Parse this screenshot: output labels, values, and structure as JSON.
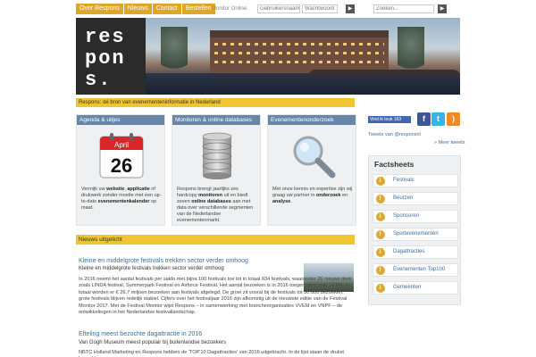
{
  "nav": {
    "tabs": [
      "Over Respons",
      "Nieuws",
      "Contact",
      "Bestellen"
    ],
    "monitor_label": "Monitor Online:",
    "username_placeholder": "Gebruikersnaam",
    "password_placeholder": "Wachtwoord",
    "search_placeholder": "Zoeken...",
    "go_glyph": "▶"
  },
  "logo": {
    "letters": "res\npon\ns."
  },
  "tagline": "Respons: dé bron van evenementeninformatie in Nederland",
  "boxes": [
    {
      "header": "Agenda & uitjes",
      "calendar_month": "April",
      "calendar_day": "26",
      "text_parts": [
        "Vermijk uw ",
        "website",
        ", ",
        "applicatie",
        " of drukwerk zonder moeite met een up-to-date ",
        "evenementenkalender",
        " op maat."
      ]
    },
    {
      "header": "Monitoren & online databases",
      "text_parts": [
        "Respons brengt jaarlijks zes hardcopy ",
        "monitoren",
        " uit en biedt zeven ",
        "online databases",
        " aan met data over verschillende segmenten van de Nederlandse evenementenmarkt."
      ]
    },
    {
      "header": "Evenementenonderzoek",
      "text_parts": [
        "Met onze kennis en expertise zijn wij graag uw partner in ",
        "onderzoek",
        " en ",
        "analyse",
        "."
      ]
    }
  ],
  "news": {
    "header": "Nieuws uitgelicht",
    "items": [
      {
        "title": "Kleine en middelgrote festivals trekken sector verder omhoog",
        "subtitle": "Kleine en middelgrote festivals trekken sector verder omhoog",
        "body": "In 2016 neemt het aantal festivals per saldo met bijna 100 festivals toe tot in totaal 934 festivals, waaronder 26 nieuwe titels zoals LINDA festival, Summerpark Festival en Airforce Festival. Het aantal bezoeken is in 2016 toegenomen met 14,6%: in totaal worden er € 26,7 miljoen bezoeken aan festivals afgelegd. De groei zit vooral bij de festivals tot 30.000 bezoeken, grote festivals blijven redelijk stabiel. Cijfers over het festivaljaar 2016 zijn afkomstig uit de nieuwste editie van de Festival Monitor 2017. Met de Festival Monitor wijst Respons – in samenwerking met brancheorganisaties VVEM en VNPF – de ontwikkelingen in het Nederlandse festivallandschap."
      },
      {
        "title": "Efteling meest bezochte dagattractie in 2016",
        "subtitle": "Van Gogh Museum meest populair bij buitenlandse bezoekers",
        "body": "NBTC Holland Marketing en Respons hebben de 'TOP'10 Dagattracties' van 2016 uitgebracht. In de lijst staan de drukst bezochte"
      }
    ]
  },
  "sidebar": {
    "like_label": "Vind ik leuk",
    "like_count": "163",
    "social": [
      {
        "name": "facebook",
        "glyph": "f",
        "color": "#3b5998"
      },
      {
        "name": "twitter",
        "glyph": "t",
        "color": "#33b5e8"
      },
      {
        "name": "rss",
        "glyph": ")",
        "color": "#f08a24"
      }
    ],
    "tweets_label": "Tweets van @responsnl",
    "more_tweets": "» Meer tweets",
    "factsheets_title": "Factsheets",
    "factsheets": [
      "Festivals",
      "Beurzen",
      "Sponsoren",
      "Sportevenementen",
      "Dagattracties",
      "Evenementen Top100",
      "Gemeenten"
    ]
  },
  "colors": {
    "nav_tab": "#dda826",
    "box_header": "#6886a8",
    "link": "#3c6ea0",
    "accent_bar": "#f1c433"
  }
}
